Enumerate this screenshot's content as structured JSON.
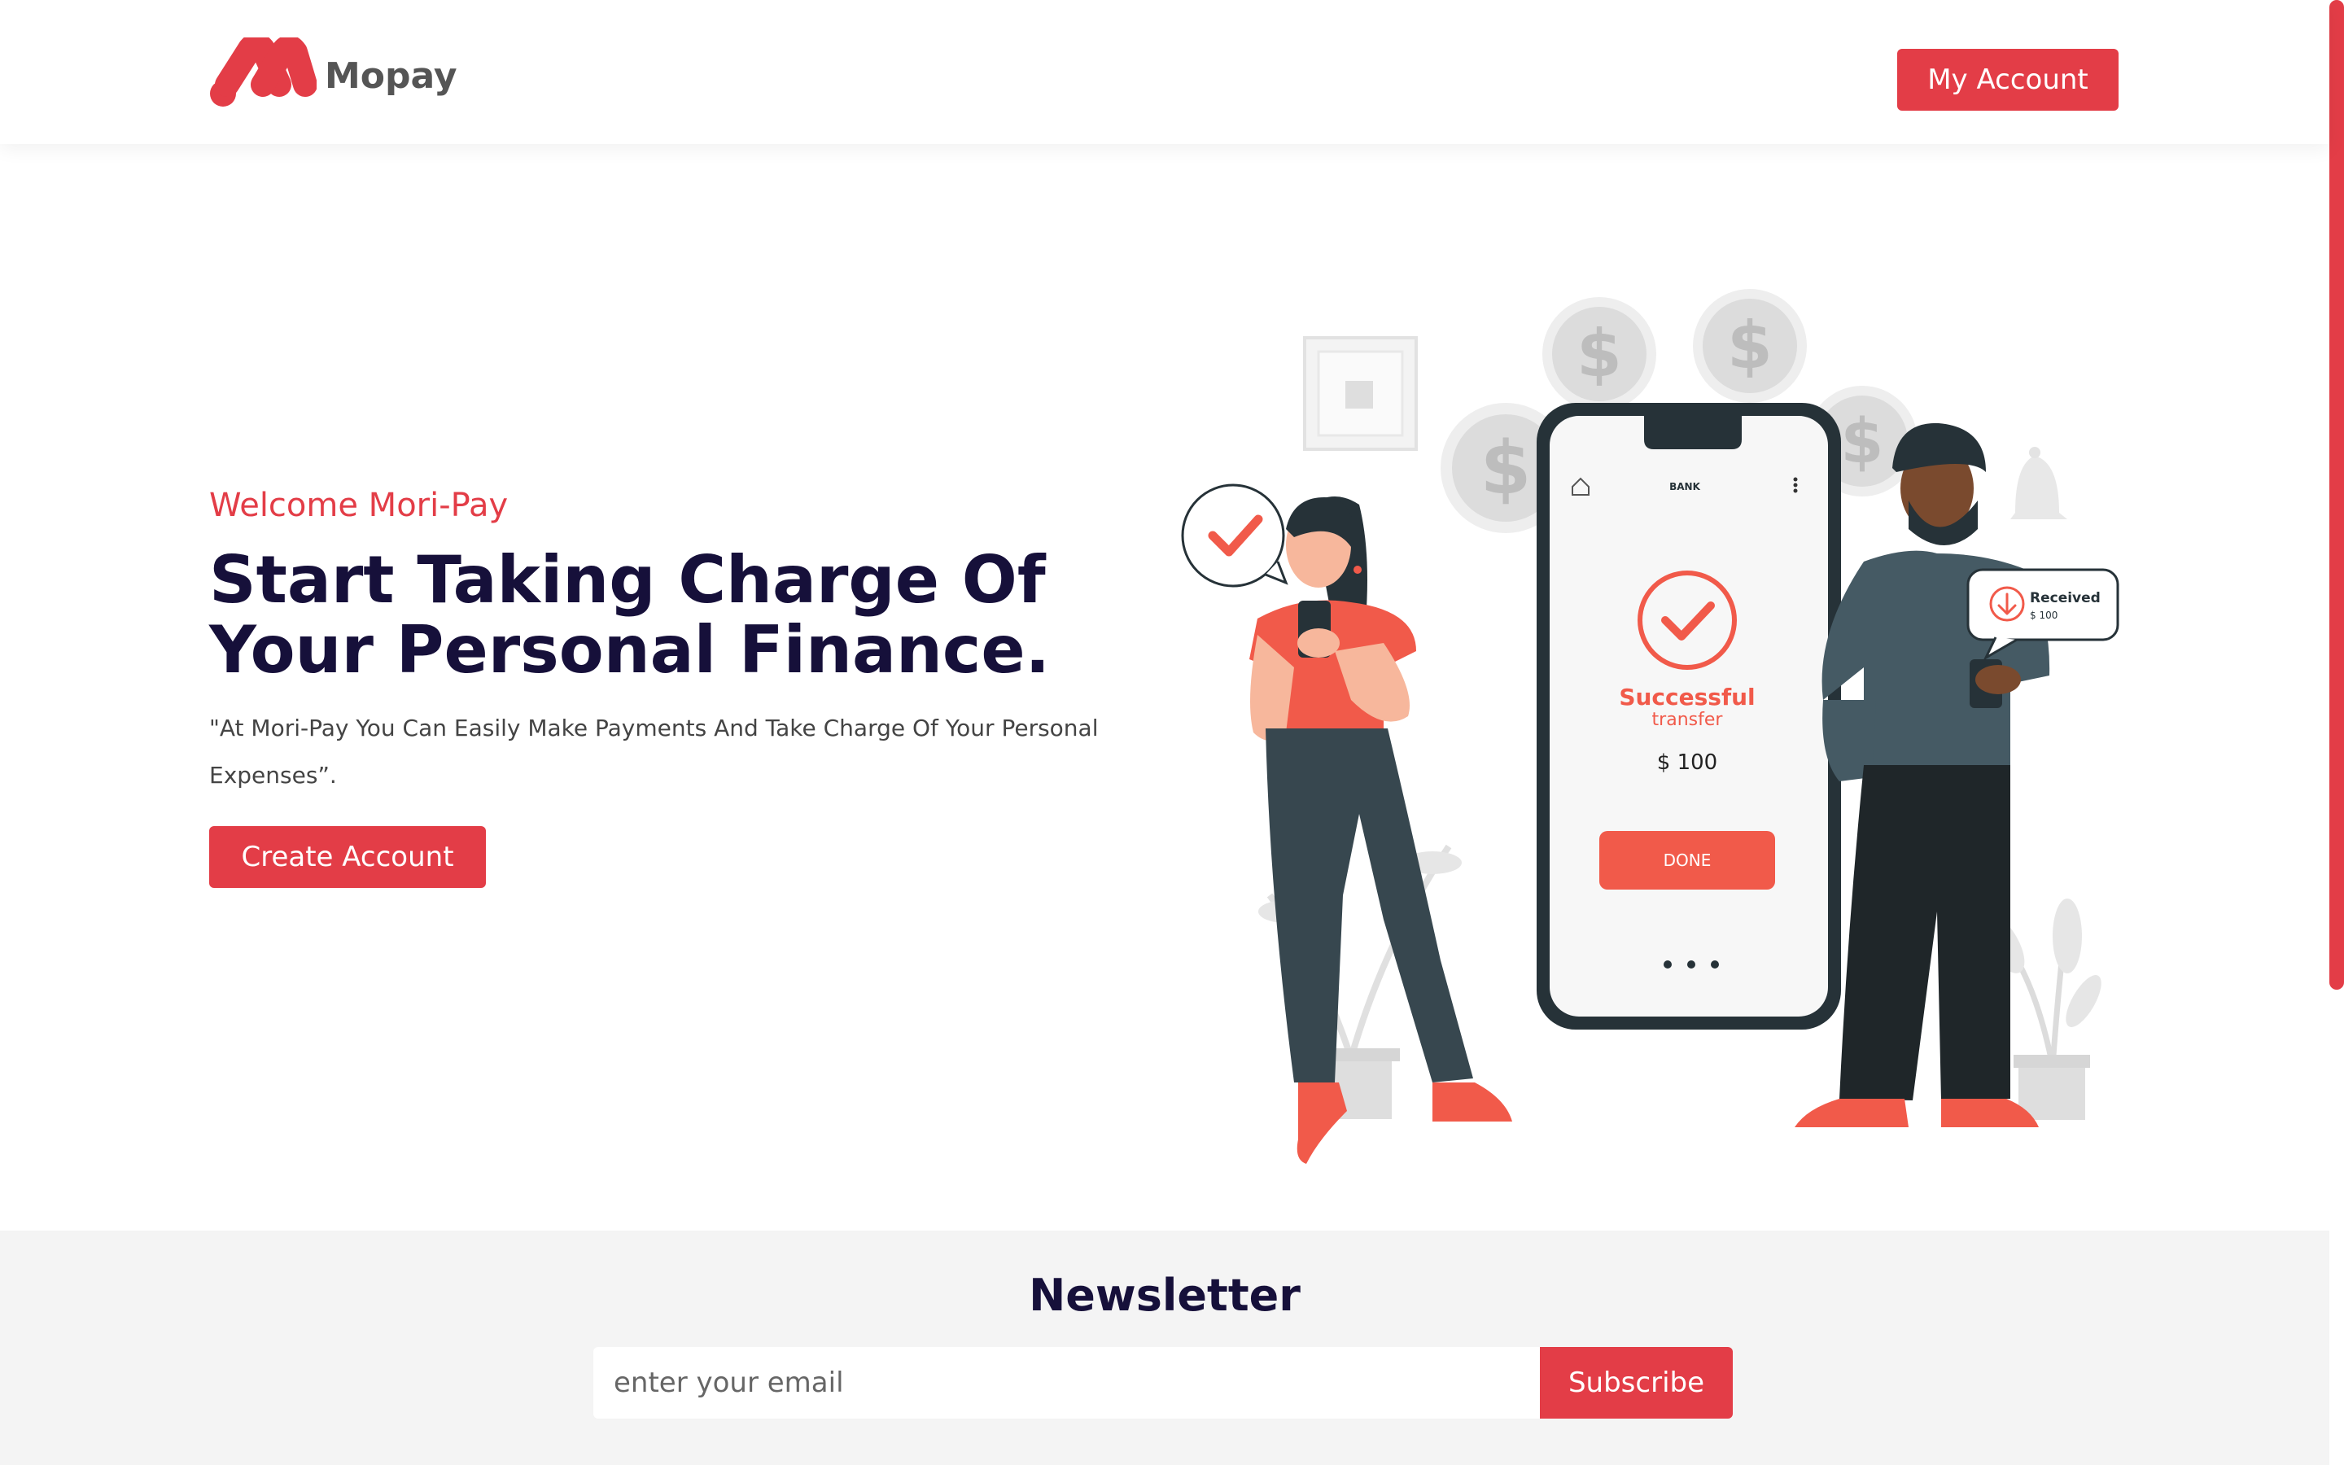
{
  "brand": {
    "name": "Mopay",
    "accent_color": "#e33d47",
    "heading_color": "#16103a"
  },
  "header": {
    "account_button_label": "My Account"
  },
  "hero": {
    "eyebrow": "Welcome Mori-Pay",
    "title": "Start Taking Charge Of Your Personal Finance.",
    "description": "\"At Mori-Pay You Can Easily Make Payments And Take Charge Of Your Personal Expenses”.",
    "cta_label": "Create Account"
  },
  "illustration": {
    "phone_header": "BANK",
    "status_title": "Successful",
    "status_subtitle": "transfer",
    "amount": "$ 100",
    "done_label": "DONE",
    "received_label": "Received",
    "received_amount": "$ 100",
    "coin_symbol": "$",
    "icons": [
      "check-icon",
      "home-icon",
      "more-icon",
      "download-icon",
      "bell-icon",
      "coin-icon",
      "plant-icon"
    ]
  },
  "newsletter": {
    "title": "Newsletter",
    "email_placeholder": "enter your email",
    "subscribe_label": "Subscribe"
  }
}
